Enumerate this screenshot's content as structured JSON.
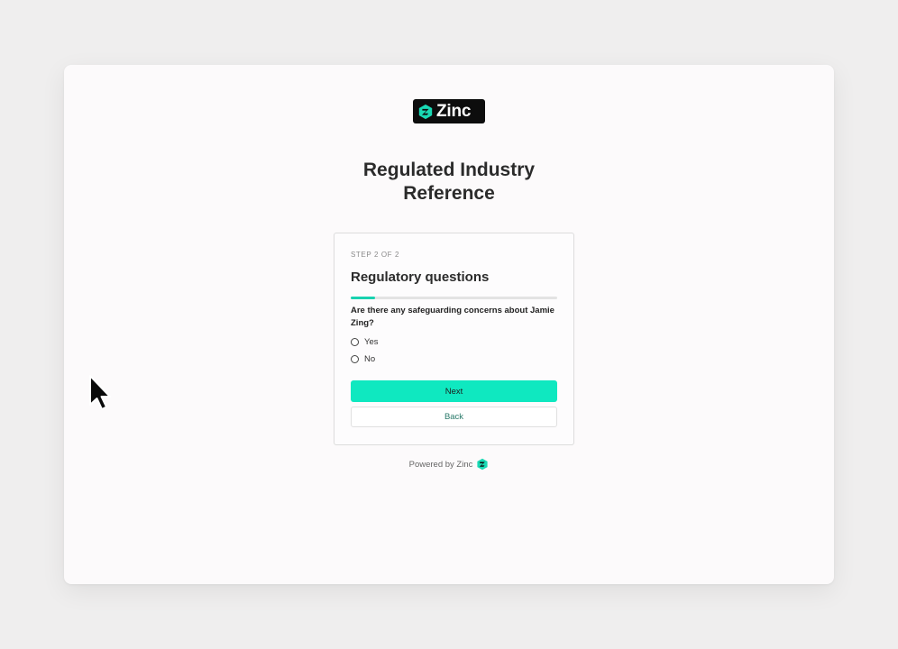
{
  "brand": {
    "name": "Zinc",
    "logo_icon": "zinc-logo-icon",
    "accent_color": "#0fe8c0"
  },
  "page": {
    "title_line1": "Regulated Industry",
    "title_line2": "Reference"
  },
  "form": {
    "step_label": "STEP 2 OF 2",
    "section_title": "Regulatory questions",
    "progress_fraction": 0.12,
    "question": "Are there any safeguarding concerns about Jamie Zing?",
    "options": [
      {
        "label": "Yes",
        "selected": false
      },
      {
        "label": "No",
        "selected": false
      }
    ],
    "next_label": "Next",
    "back_label": "Back"
  },
  "footer": {
    "powered_by": "Powered by Zinc"
  }
}
